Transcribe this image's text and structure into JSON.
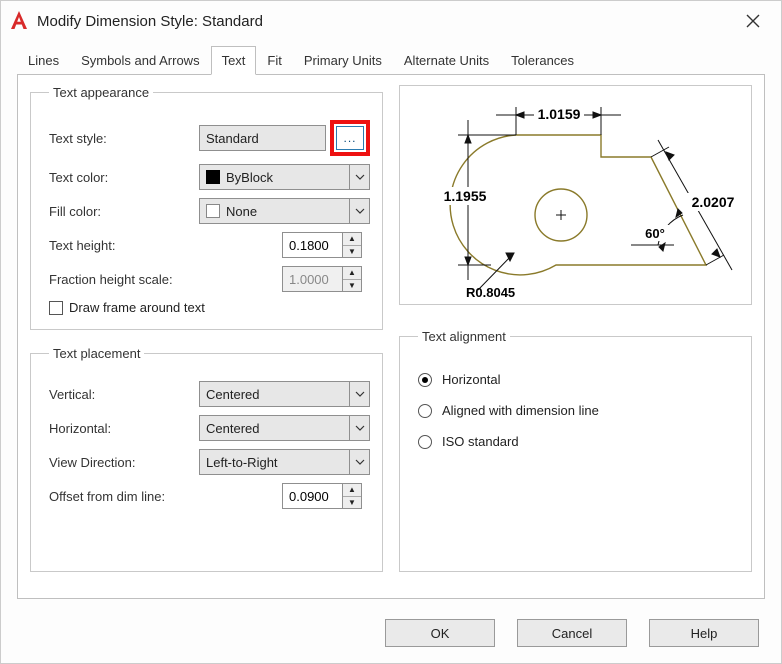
{
  "window": {
    "title": "Modify Dimension Style: Standard"
  },
  "tabs": {
    "items": [
      {
        "label": "Lines"
      },
      {
        "label": "Symbols and Arrows"
      },
      {
        "label": "Text"
      },
      {
        "label": "Fit"
      },
      {
        "label": "Primary Units"
      },
      {
        "label": "Alternate Units"
      },
      {
        "label": "Tolerances"
      }
    ],
    "active_index": 2
  },
  "appearance": {
    "legend": "Text appearance",
    "text_style": {
      "label": "Text style:",
      "value": "Standard",
      "ellipsis": "..."
    },
    "text_color": {
      "label": "Text color:",
      "value": "ByBlock"
    },
    "fill_color": {
      "label": "Fill color:",
      "value": "None"
    },
    "text_height": {
      "label": "Text height:",
      "value": "0.1800"
    },
    "fraction_height_scale": {
      "label": "Fraction height scale:",
      "value": "1.0000"
    },
    "draw_frame": {
      "label": "Draw frame around text",
      "checked": false
    }
  },
  "placement": {
    "legend": "Text placement",
    "vertical": {
      "label": "Vertical:",
      "value": "Centered"
    },
    "horizontal": {
      "label": "Horizontal:",
      "value": "Centered"
    },
    "view_direction": {
      "label": "View Direction:",
      "value": "Left-to-Right"
    },
    "offset": {
      "label": "Offset from dim line:",
      "value": "0.0900"
    }
  },
  "alignment": {
    "legend": "Text alignment",
    "options": {
      "horizontal": "Horizontal",
      "aligned": "Aligned with dimension line",
      "iso": "ISO standard"
    },
    "selected": "horizontal"
  },
  "preview": {
    "dim_top": "1.0159",
    "dim_left": "1.1955",
    "dim_diag": "2.0207",
    "angle": "60°",
    "radius": "R0.8045"
  },
  "buttons": {
    "ok": "OK",
    "cancel": "Cancel",
    "help": "Help"
  }
}
